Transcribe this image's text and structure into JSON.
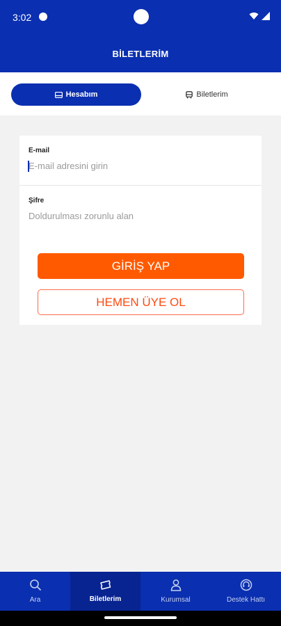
{
  "status": {
    "time": "3:02"
  },
  "header": {
    "title": "BİLETLERİM"
  },
  "tabs": [
    {
      "label": "Hesabım",
      "icon": "card-icon",
      "active": true
    },
    {
      "label": "Biletlerim",
      "icon": "bus-icon",
      "active": false
    }
  ],
  "form": {
    "email": {
      "label": "E-mail",
      "placeholder": "E-mail adresini girin",
      "value": ""
    },
    "password": {
      "label": "Şifre",
      "placeholder": "Doldurulması zorunlu alan",
      "value": ""
    },
    "login_label": "GİRİŞ YAP",
    "register_label": "HEMEN ÜYE OL"
  },
  "bottom_nav": [
    {
      "label": "Ara",
      "icon": "search-icon",
      "active": false
    },
    {
      "label": "Biletlerim",
      "icon": "ticket-icon",
      "active": true
    },
    {
      "label": "Kurumsal",
      "icon": "person-icon",
      "active": false
    },
    {
      "label": "Destek Hattı",
      "icon": "headset-icon",
      "active": false
    }
  ],
  "colors": {
    "brand": "#0a2fb0",
    "accent": "#ff5a00",
    "background": "#f2f2f2"
  }
}
